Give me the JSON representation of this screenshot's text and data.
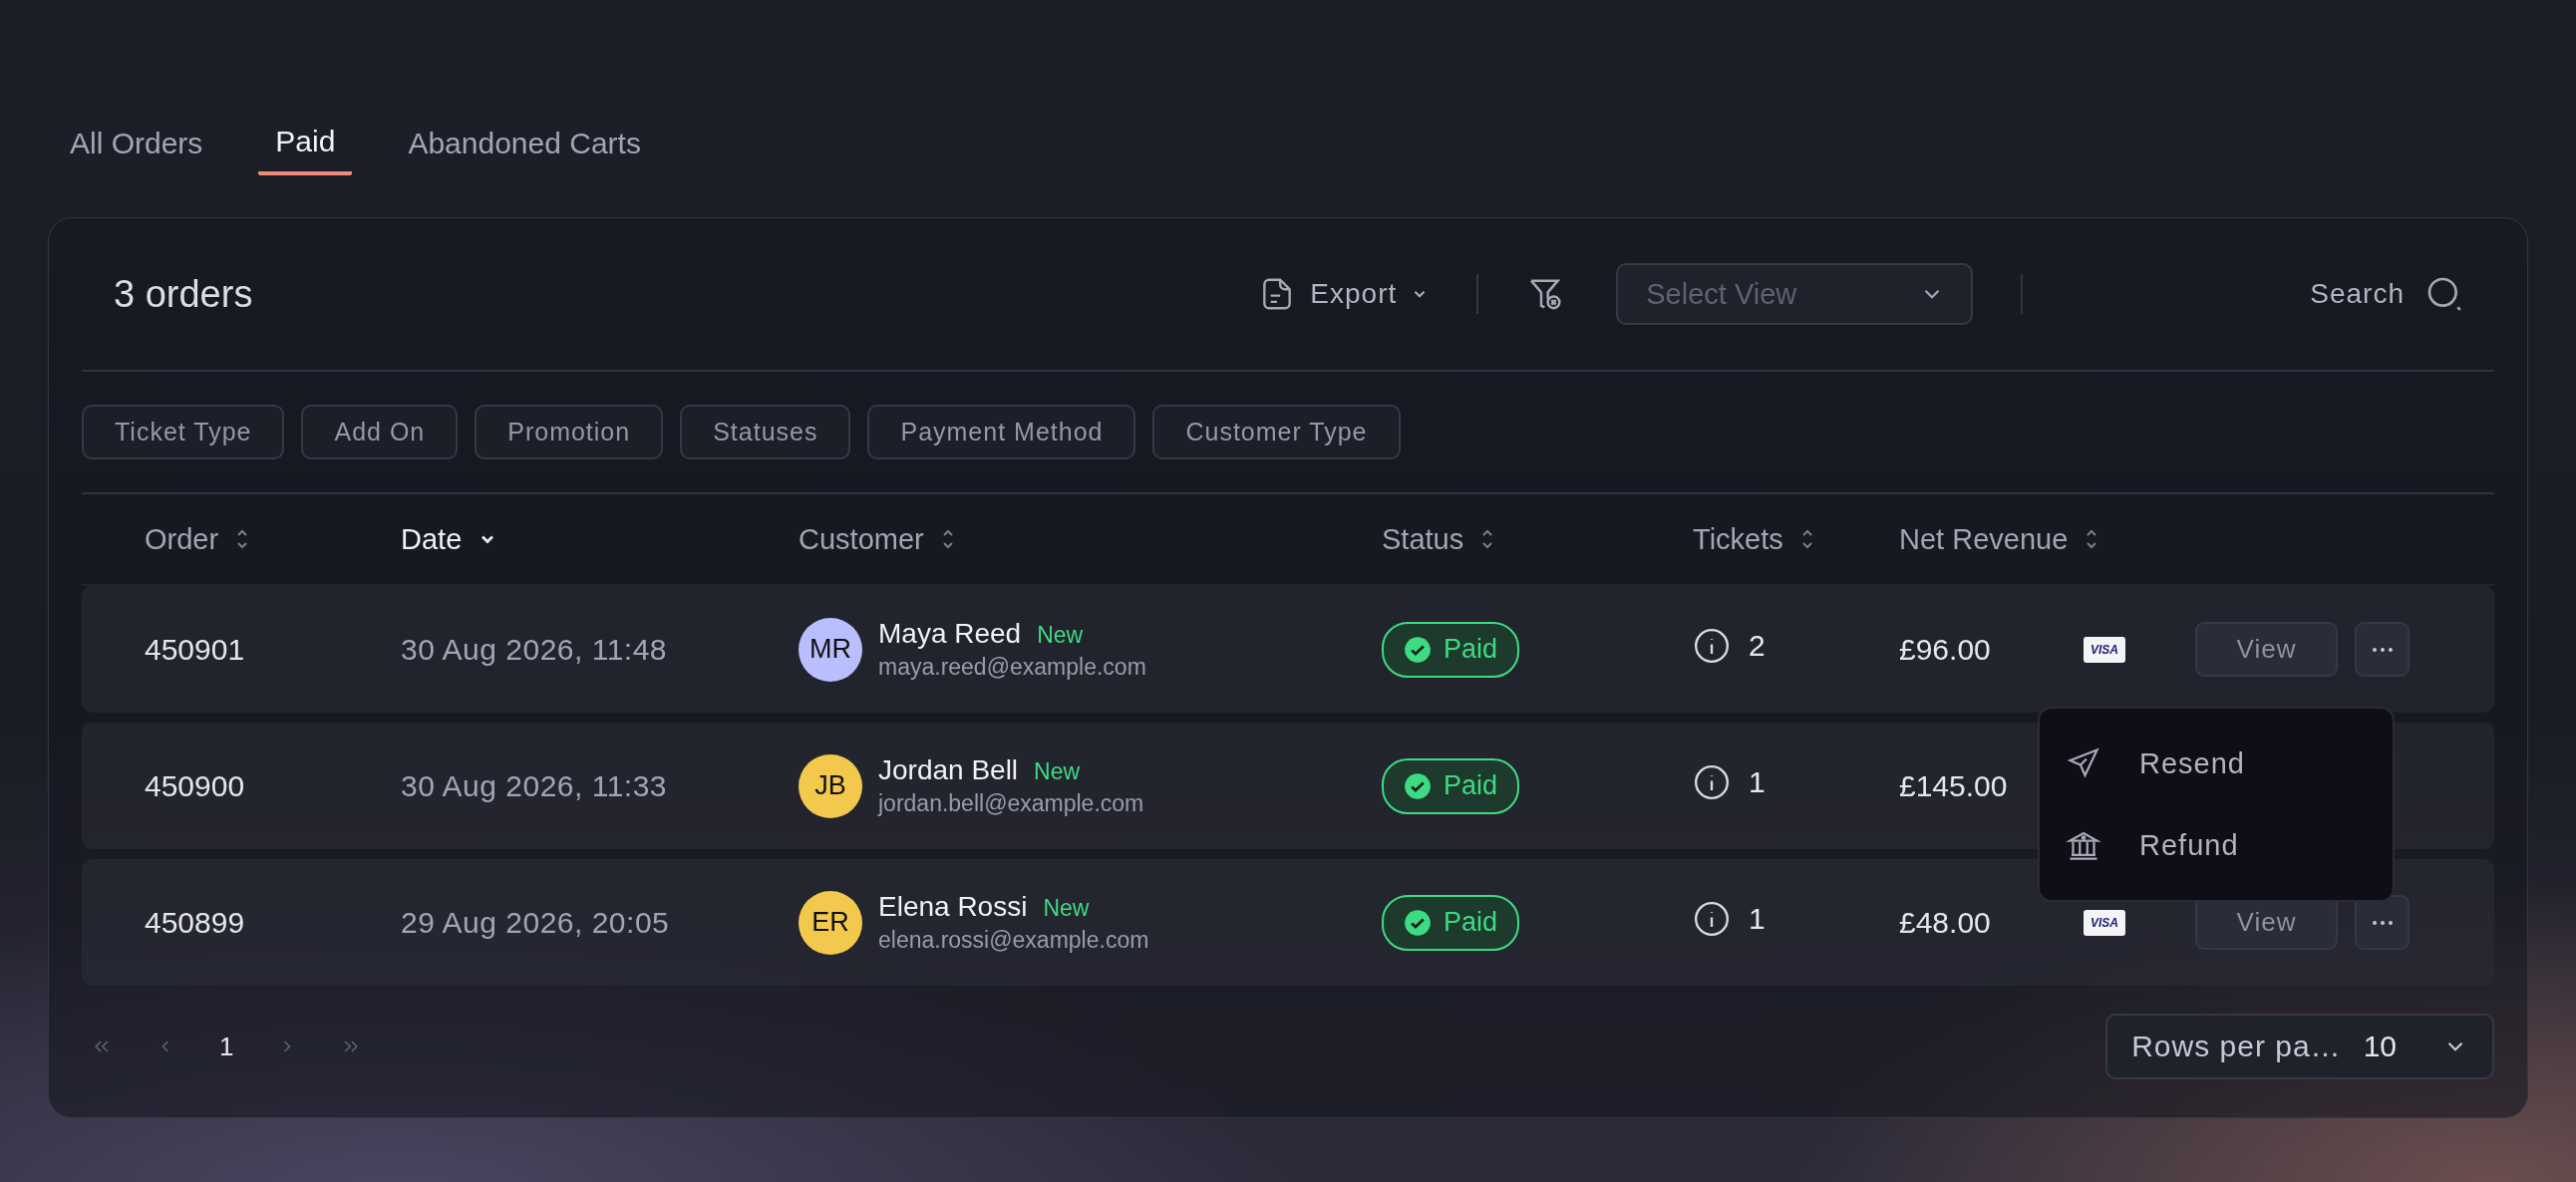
{
  "tabs": [
    {
      "label": "All Orders",
      "selected": false
    },
    {
      "label": "Paid",
      "selected": true
    },
    {
      "label": "Abandoned Carts",
      "selected": false
    }
  ],
  "toolbar": {
    "count": "3 orders",
    "export": "Export",
    "view_select": {
      "placeholder": "Select View"
    },
    "search": "Search"
  },
  "filters": [
    "Ticket Type",
    "Add On",
    "Promotion",
    "Statuses",
    "Payment Method",
    "Customer Type"
  ],
  "table": {
    "columns": [
      {
        "label": "Order",
        "sorted": false
      },
      {
        "label": "Date",
        "sorted": true
      },
      {
        "label": "Customer",
        "sorted": false
      },
      {
        "label": "Status",
        "sorted": false
      },
      {
        "label": "Tickets",
        "sorted": false
      },
      {
        "label": "Net Revenue",
        "sorted": false
      }
    ],
    "rows": [
      {
        "order": "450901",
        "date": "30 Aug 2026, 11:48",
        "initials": "MR",
        "color": "#b9befe",
        "name": "Maya Reed",
        "badge": "New",
        "email": "maya.reed@example.com",
        "status": {
          "label": "Paid",
          "kind": "paid"
        },
        "tickets": "2",
        "revenue": "£96.00",
        "card": "VISA",
        "view": "View",
        "more": true
      },
      {
        "order": "450900",
        "date": "30 Aug 2026, 11:33",
        "initials": "JB",
        "color": "#f2c94c",
        "name": "Jordan Bell",
        "badge": "New",
        "email": "jordan.bell@example.com",
        "status": {
          "label": "Paid",
          "kind": "paid"
        },
        "tickets": "1",
        "revenue": "£145.00",
        "more": false
      },
      {
        "order": "450899",
        "date": "29 Aug 2026, 20:05",
        "initials": "ER",
        "color": "#f2c94c",
        "name": "Elena Rossi",
        "badge": "New",
        "email": "elena.rossi@example.com",
        "status": {
          "label": "Paid",
          "kind": "paid"
        },
        "tickets": "1",
        "revenue": "£48.00",
        "card": "VISA",
        "view": "View",
        "more": true
      }
    ],
    "row_menu": {
      "items": [
        {
          "label": "Resend",
          "kind": "send"
        },
        {
          "label": "Refund",
          "kind": "bank"
        }
      ]
    }
  },
  "pagination": {
    "pages": [
      {
        "label": "1",
        "selected": true
      }
    ],
    "rows_per_page": {
      "label": "Rows per pa…",
      "value": "10"
    }
  }
}
